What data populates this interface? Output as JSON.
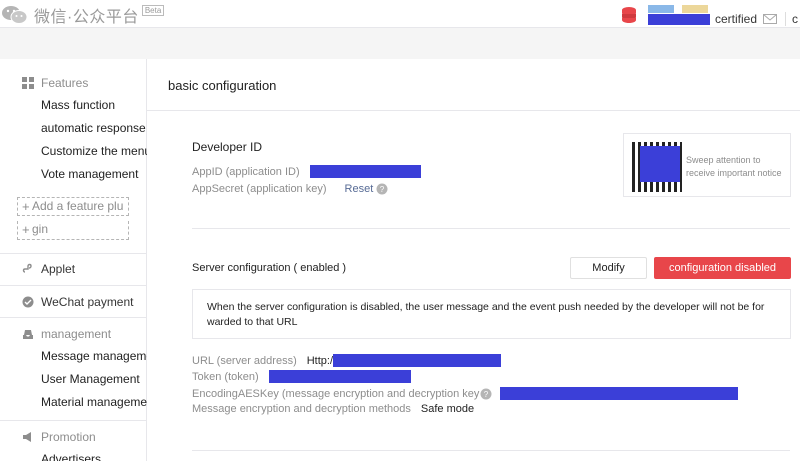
{
  "header": {
    "brand": "微信·公众平台",
    "beta": "Beta",
    "account_status": "certified",
    "truncated_link": "c"
  },
  "sidebar": {
    "features": {
      "label": "Features",
      "items": [
        "Mass function",
        "automatic response",
        "Customize the menu",
        "Vote management"
      ],
      "add_plugin": "Add a feature plu",
      "extra": "gin"
    },
    "applet": "Applet",
    "wechat_payment": "WeChat payment",
    "management": {
      "label": "management",
      "items": [
        "Message manageme...",
        "User Management",
        "Material management"
      ]
    },
    "promotion": {
      "label": "Promotion",
      "items": [
        "Advertisers"
      ]
    }
  },
  "main": {
    "title": "basic configuration",
    "developer": {
      "title": "Developer ID",
      "appid_label": "AppID (application ID)",
      "appsecret_label": "AppSecret (application key)",
      "reset": "Reset"
    },
    "qr": {
      "line1": "Sweep attention to",
      "line2": "receive important notice"
    },
    "server": {
      "title": "Server configuration ( enabled )",
      "modify": "Modify",
      "disable": "configuration disabled",
      "notice": "When the server configuration is disabled, the user message and the event push needed by the developer will not be for warded to that URL",
      "url_label": "URL (server address)",
      "url_prefix": "Http:/",
      "token_label": "Token (token)",
      "aes_label": "EncodingAESKey (message encryption and decryption key",
      "method_label": "Message encryption and decryption methods",
      "method_value": "Safe mode"
    }
  },
  "colors": {
    "redaction": "#3b3fd8",
    "danger": "#e8464a",
    "link": "#576b95"
  }
}
